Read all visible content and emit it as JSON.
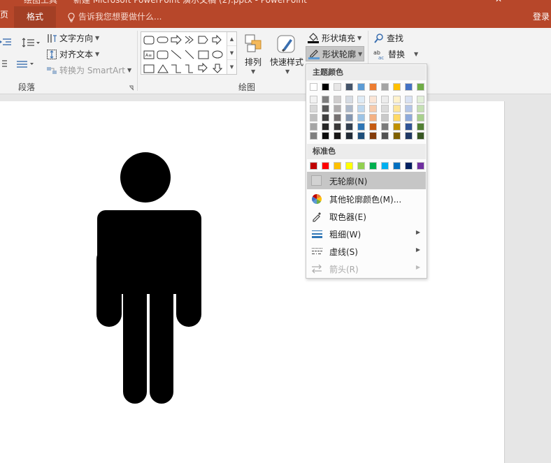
{
  "titlebar": {
    "left_tab_partial": "绘图工具",
    "document_title": "新建 Microsoft PowerPoint 演示文稿 (2).pptx - PowerPoint",
    "close_glyph": "✕"
  },
  "tabs": {
    "edge_label": "页",
    "active_label": "格式",
    "tell_me": "告诉我您想要做什么...",
    "login": "登录"
  },
  "ribbon": {
    "paragraph": {
      "text_direction": "文字方向",
      "align_text": "对齐文本",
      "convert_smartart": "转换为 SmartArt",
      "group_label": "段落"
    },
    "drawing": {
      "arrange": "排列",
      "quick_styles": "快速样式",
      "shape_fill": "形状填充",
      "shape_outline": "形状轮廓",
      "group_label": "绘图"
    },
    "editing": {
      "find": "查找",
      "replace": "替换"
    }
  },
  "outline_menu": {
    "theme_colors_heading": "主题颜色",
    "standard_colors_heading": "标准色",
    "theme_colors": [
      "#ffffff",
      "#000000",
      "#e7e6e6",
      "#44546a",
      "#5b9bd5",
      "#ed7d31",
      "#a5a5a5",
      "#ffc000",
      "#4472c4",
      "#70ad47"
    ],
    "theme_shades": [
      [
        "#f2f2f2",
        "#7f7f7f",
        "#d0cece",
        "#d6dce4",
        "#deebf6",
        "#fbe5d5",
        "#ededed",
        "#fff2cc",
        "#d9e2f3",
        "#e2efd9"
      ],
      [
        "#d8d8d8",
        "#595959",
        "#aeabab",
        "#adb9ca",
        "#bdd7ee",
        "#f7cbac",
        "#dbdbdb",
        "#fee599",
        "#b4c6e7",
        "#c5e0b3"
      ],
      [
        "#bfbfbf",
        "#3f3f3f",
        "#757070",
        "#8496b0",
        "#9cc3e5",
        "#f4b183",
        "#c9c9c9",
        "#ffd965",
        "#8eaadb",
        "#a8d08d"
      ],
      [
        "#a5a5a5",
        "#262626",
        "#3a3838",
        "#323f4f",
        "#2e75b5",
        "#c55a11",
        "#7b7b7b",
        "#bf9000",
        "#2f5496",
        "#538135"
      ],
      [
        "#7f7f7f",
        "#0c0c0c",
        "#171616",
        "#222a35",
        "#1e4e79",
        "#833c0b",
        "#525252",
        "#7f6000",
        "#1f3864",
        "#375623"
      ]
    ],
    "standard_colors": [
      "#c00000",
      "#ff0000",
      "#ffc000",
      "#ffff00",
      "#92d050",
      "#00b050",
      "#00b0f0",
      "#0070c0",
      "#002060",
      "#7030a0"
    ],
    "items": {
      "no_outline": "无轮廓(N)",
      "more_colors": "其他轮廓颜色(M)...",
      "eyedropper": "取色器(E)",
      "weight": "粗细(W)",
      "dashes": "虚线(S)",
      "arrows": "箭头(R)"
    }
  }
}
